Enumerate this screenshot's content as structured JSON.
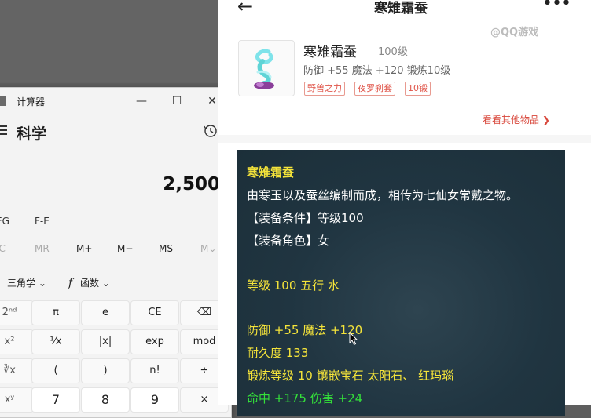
{
  "calculator": {
    "title": "计算器",
    "mode": "科学",
    "display": "2,500",
    "fe_left": "EG",
    "fe_right": "F-E",
    "memory": [
      "IC",
      "MR",
      "M+",
      "M−",
      "MS",
      "M⌄"
    ],
    "trig": "三角学",
    "func": "函数",
    "func_icon": "f",
    "chevron": "⌄",
    "rows": [
      [
        "2ⁿᵈ",
        "π",
        "e",
        "CE",
        "⌫"
      ],
      [
        "x²",
        "¹⁄x",
        "|x|",
        "exp",
        "mod"
      ],
      [
        "∛x",
        "(",
        ")",
        "n!",
        "÷"
      ],
      [
        "xʸ",
        "7",
        "8",
        "9",
        "×"
      ]
    ],
    "win_minimize": "—",
    "win_maximize": "☐",
    "win_close": "✕"
  },
  "app": {
    "back": "←",
    "title": "寒雉霜蚕",
    "more": "•••",
    "watermark": "@QQ游戏",
    "item": {
      "name": "寒雉霜蚕",
      "level": "100级",
      "stats": "防御 +55 魔法 +120 锻炼10级",
      "tags": [
        "野兽之力",
        "夜罗刹套",
        "10锻"
      ]
    },
    "see_more": "看看其他物品 ❯",
    "description": [
      {
        "text": "寒雉霜蚕",
        "color": "yellow",
        "bold": true
      },
      {
        "text": "由寒玉以及蚕丝编制而成，相传为七仙女常戴之物。",
        "color": "white"
      },
      {
        "text": "【装备条件】等级100",
        "color": "white"
      },
      {
        "text": "【装备角色】女",
        "color": "white"
      },
      {
        "text": "等级 100 五行 水",
        "color": "yellow"
      },
      {
        "text": "防御 +55 魔法 +120",
        "color": "yellow"
      },
      {
        "text": "耐久度 133",
        "color": "yellow"
      },
      {
        "text": "锻炼等级 10 镶嵌宝石 太阳石、 红玛瑙",
        "color": "yellow"
      },
      {
        "text": "命中 +175 伤害 +24",
        "color": "green"
      }
    ]
  },
  "colors": {
    "accent_red": "#d8463a",
    "desc_yellow": "#f5e43a",
    "desc_green": "#34e03a",
    "desc_bg": "#203541"
  }
}
